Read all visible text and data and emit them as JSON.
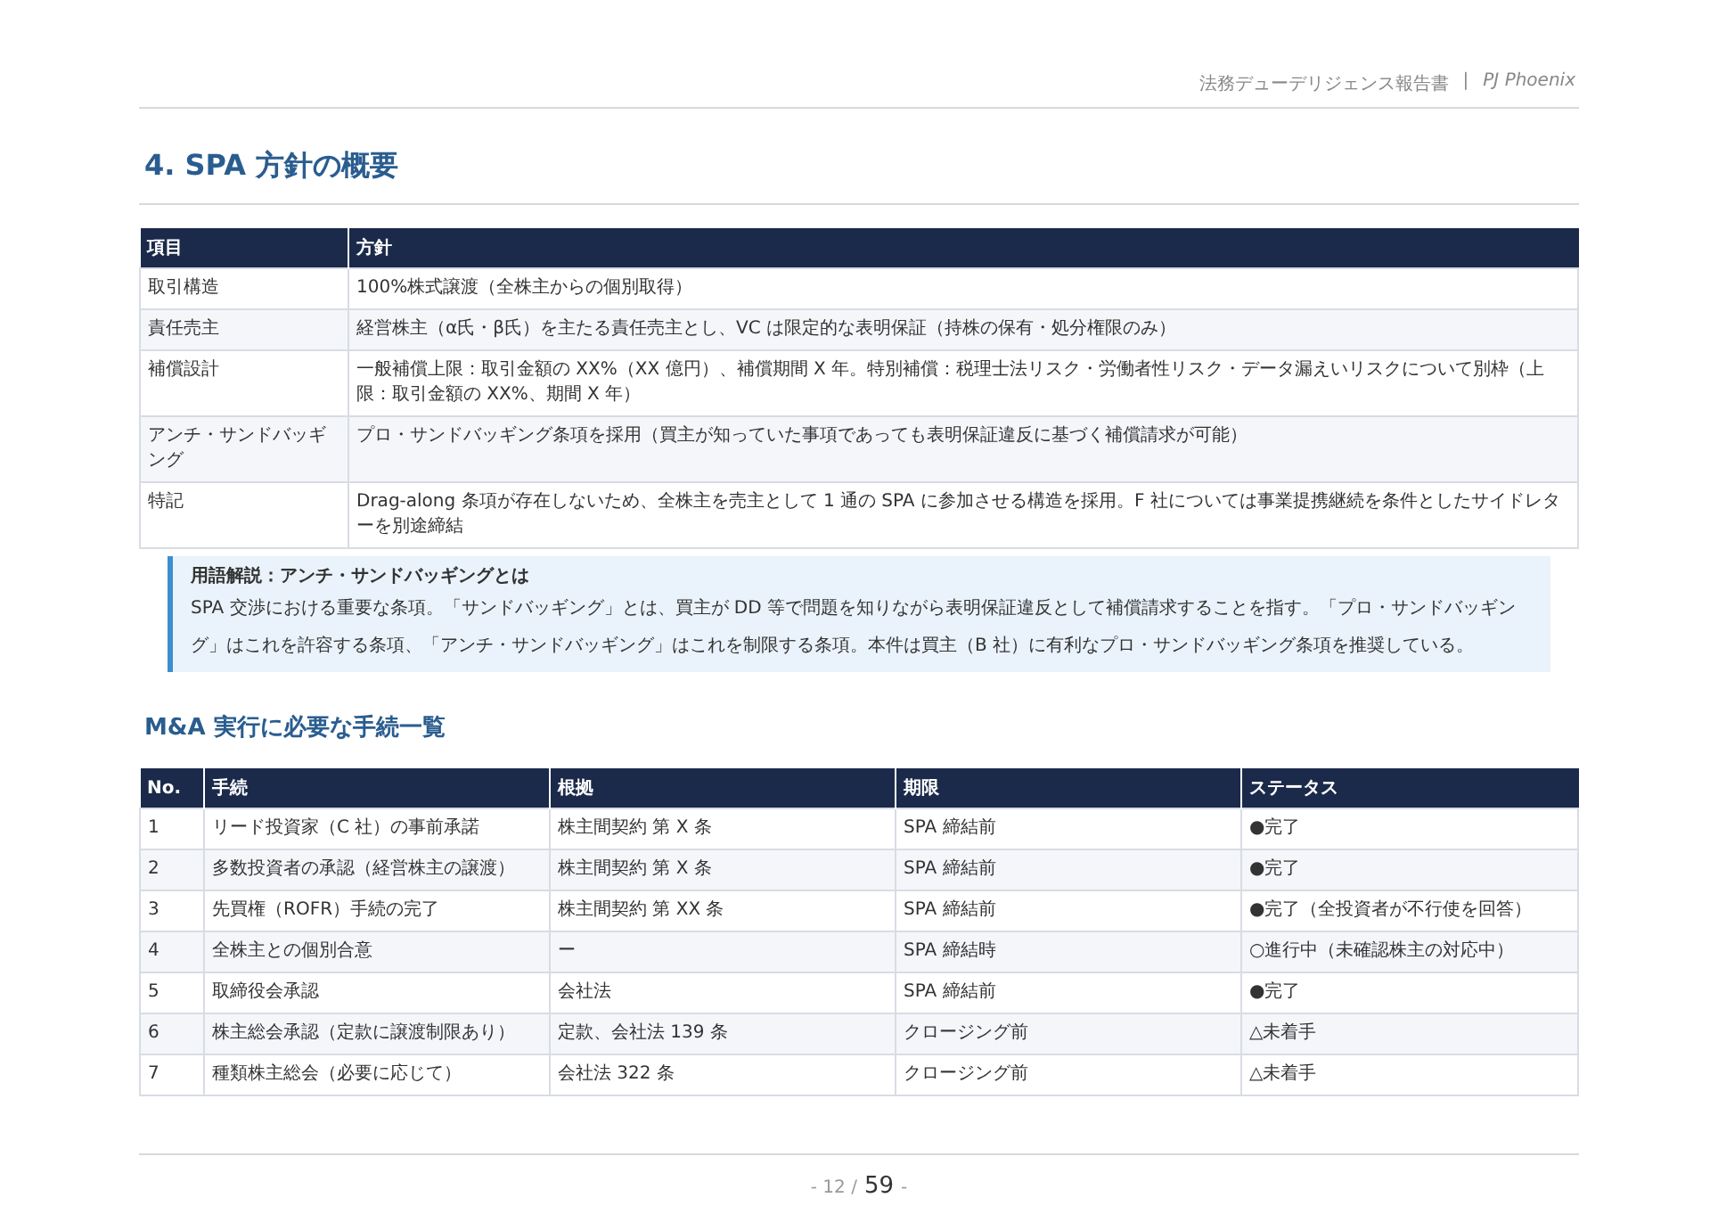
{
  "header": {
    "document": "法務デューデリジェンス報告書",
    "separator": "|",
    "project": "PJ Phoenix"
  },
  "section_title": "4. SPA 方針の概要",
  "policy_table": {
    "columns": [
      "項目",
      "方針"
    ],
    "rows": [
      [
        "取引構造",
        "100%株式譲渡（全株主からの個別取得）"
      ],
      [
        "責任売主",
        "経営株主（α氏・β氏）を主たる責任売主とし、VC は限定的な表明保証（持株の保有・処分権限のみ）"
      ],
      [
        "補償設計",
        "一般補償上限：取引金額の XX%（XX 億円）、補償期間 X 年。特別補償：税理士法リスク・労働者性リスク・データ漏えいリスクについて別枠（上限：取引金額の XX%、期間 X 年）"
      ],
      [
        "アンチ・サンドバッギング",
        "プロ・サンドバッギング条項を採用（買主が知っていた事項であっても表明保証違反に基づく補償請求が可能）"
      ],
      [
        "特記",
        "Drag-along 条項が存在しないため、全株主を売主として 1 通の SPA に参加させる構造を採用。F 社については事業提携継続を条件としたサイドレターを別途締結"
      ]
    ]
  },
  "note": {
    "title": "用語解説：アンチ・サンドバッギングとは",
    "body": "SPA 交渉における重要な条項。「サンドバッギング」とは、買主が DD 等で問題を知りながら表明保証違反として補償請求することを指す。「プロ・サンドバッギング」はこれを許容する条項、「アンチ・サンドバッギング」はこれを制限する条項。本件は買主（B 社）に有利なプロ・サンドバッギング条項を推奨している。"
  },
  "subsection_title": "M&A 実行に必要な手続一覧",
  "procedure_table": {
    "columns": [
      "No.",
      "手続",
      "根拠",
      "期限",
      "ステータス"
    ],
    "rows": [
      [
        "1",
        "リード投資家（C 社）の事前承諾",
        "株主間契約 第 X 条",
        "SPA 締結前",
        "●完了"
      ],
      [
        "2",
        "多数投資者の承認（経営株主の譲渡）",
        "株主間契約 第 X 条",
        "SPA 締結前",
        "●完了"
      ],
      [
        "3",
        "先買権（ROFR）手続の完了",
        "株主間契約 第 XX 条",
        "SPA 締結前",
        "●完了（全投資者が不行使を回答）"
      ],
      [
        "4",
        "全株主との個別合意",
        "ー",
        "SPA 締結時",
        "○進行中（未確認株主の対応中）"
      ],
      [
        "5",
        "取締役会承認",
        "会社法",
        "SPA 締結前",
        "●完了"
      ],
      [
        "6",
        "株主総会承認（定款に譲渡制限あり）",
        "定款、会社法 139 条",
        "クロージング前",
        "△未着手"
      ],
      [
        "7",
        "種類株主総会（必要に応じて）",
        "会社法 322 条",
        "クロージング前",
        "△未着手"
      ]
    ]
  },
  "footer": {
    "prefix": "- 12 /",
    "total": "59",
    "suffix": "-"
  }
}
